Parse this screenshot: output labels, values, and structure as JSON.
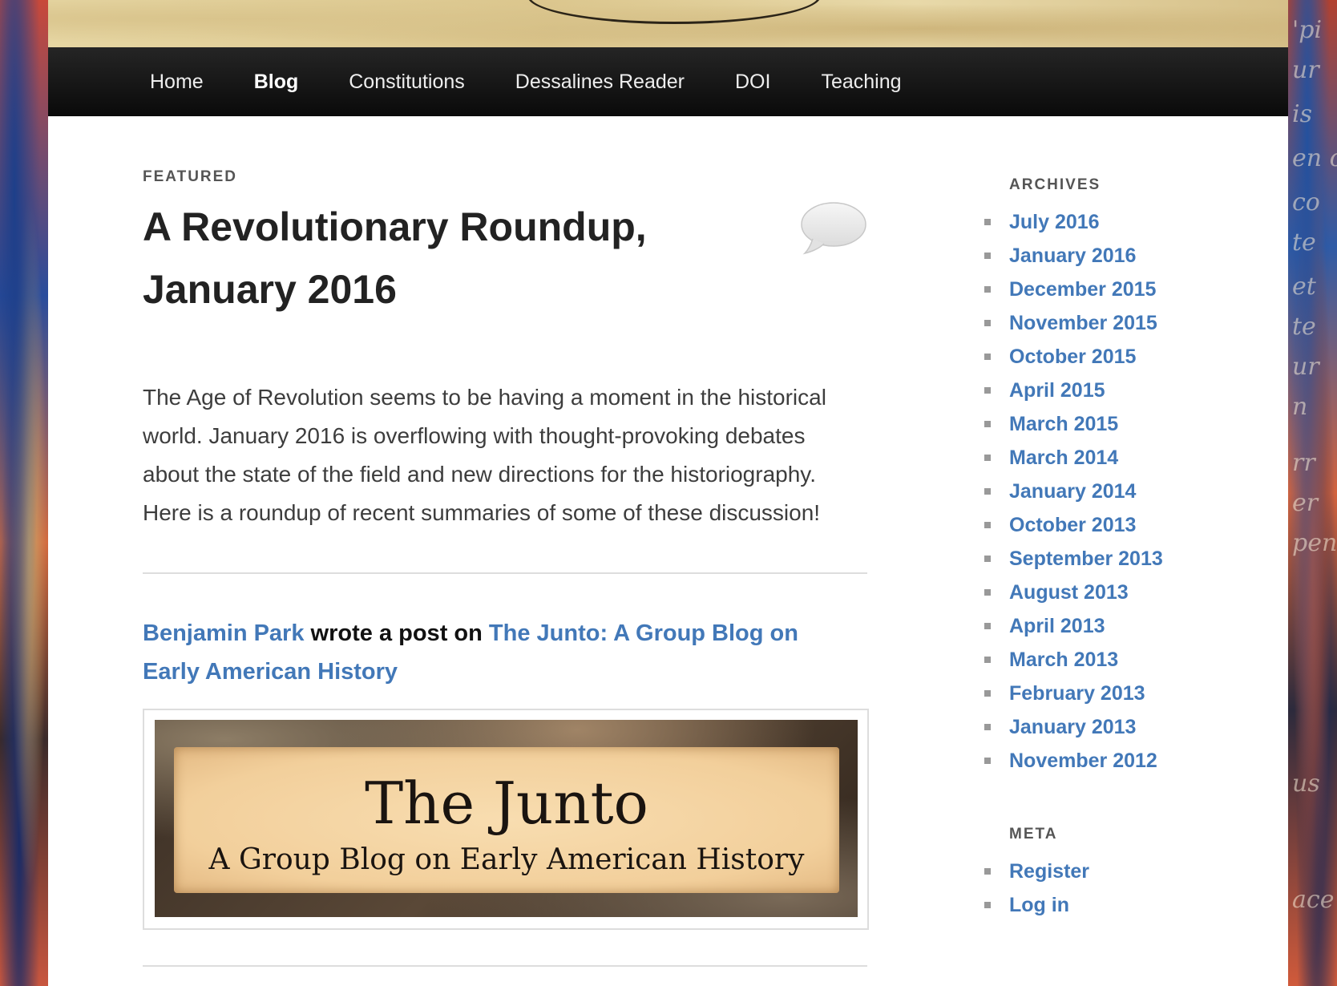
{
  "nav": {
    "items": [
      {
        "label": "Home",
        "current": false
      },
      {
        "label": "Blog",
        "current": true
      },
      {
        "label": "Constitutions",
        "current": false
      },
      {
        "label": "Dessalines Reader",
        "current": false
      },
      {
        "label": "DOI",
        "current": false
      },
      {
        "label": "Teaching",
        "current": false
      }
    ]
  },
  "post": {
    "label": "FEATURED",
    "title": "A Revolutionary Roundup, January 2016",
    "excerpt": "The Age of Revolution seems to be having a moment in the historical world. January 2016 is overflowing with thought-provoking debates about the state of the field and new directions for the historiography. Here is a roundup of recent summaries of some of these discussion!",
    "activity": {
      "author": "Benjamin Park",
      "action": "wrote a post on",
      "site": "The Junto: A Group Blog on Early American History"
    },
    "embed": {
      "title": "The Junto",
      "subtitle": "A Group Blog on Early American History"
    }
  },
  "sidebar": {
    "archives_title": "ARCHIVES",
    "archives": [
      "July 2016",
      "January 2016",
      "December 2015",
      "November 2015",
      "October 2015",
      "April 2015",
      "March 2015",
      "March 2014",
      "January 2014",
      "October 2013",
      "September 2013",
      "August 2013",
      "April 2013",
      "March 2013",
      "February 2013",
      "January 2013",
      "November 2012"
    ],
    "meta_title": "META",
    "meta": [
      "Register",
      "Log in"
    ]
  },
  "background_text": [
    "'pi",
    "ur",
    "is",
    "en c",
    "co",
    "te",
    "et",
    "te",
    "ur",
    "n",
    "rr",
    "er",
    "pen",
    "us",
    "ace"
  ],
  "colors": {
    "link": "#4278b8",
    "nav_bg": "#111111",
    "text": "#3d3d3d"
  },
  "icons": {
    "comments": "comment-bubble-icon"
  }
}
